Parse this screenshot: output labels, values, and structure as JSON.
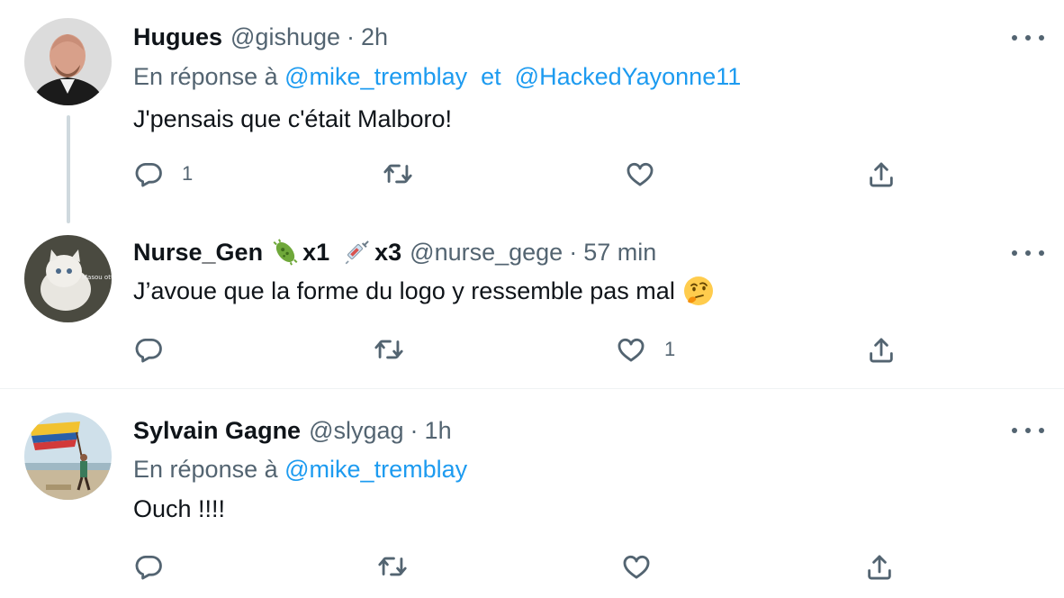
{
  "tweets": [
    {
      "display_name": "Hugues",
      "handle": "@gishuge",
      "dot": "·",
      "time": "2h",
      "reply_prefix": "En réponse à",
      "mentions": [
        "@mike_tremblay",
        "@HackedYayonne11"
      ],
      "reply_joiner": "et",
      "text": "J'pensais que c'était Malboro!",
      "counts": {
        "reply": "1",
        "retweet": "",
        "like": ""
      }
    },
    {
      "display_name": "Nurse_Gen",
      "badges": [
        {
          "icon": "microbe-icon",
          "label": "x1"
        },
        {
          "icon": "syringe-icon",
          "label": "x3"
        }
      ],
      "handle": "@nurse_gege",
      "dot": "·",
      "time": "57 min",
      "avatar_text": "Masou ott",
      "text": "J’avoue que la forme du logo y ressemble pas mal",
      "text_emoji": "thinking-face-icon",
      "counts": {
        "reply": "",
        "retweet": "",
        "like": "1"
      }
    },
    {
      "display_name": "Sylvain Gagne",
      "handle": "@slygag",
      "dot": "·",
      "time": "1h",
      "reply_prefix": "En réponse à",
      "mentions": [
        "@mike_tremblay"
      ],
      "text": "Ouch !!!!",
      "counts": {
        "reply": "",
        "retweet": "",
        "like": ""
      }
    }
  ],
  "icons": {
    "reply": "reply-icon",
    "retweet": "retweet-icon",
    "like": "heart-icon",
    "share": "share-icon",
    "more": "more-icon"
  },
  "colors": {
    "text": "#0f1419",
    "muted": "#536471",
    "link": "#1d9bf0",
    "thread_line": "#cfd9de",
    "separator": "#eff3f4"
  }
}
